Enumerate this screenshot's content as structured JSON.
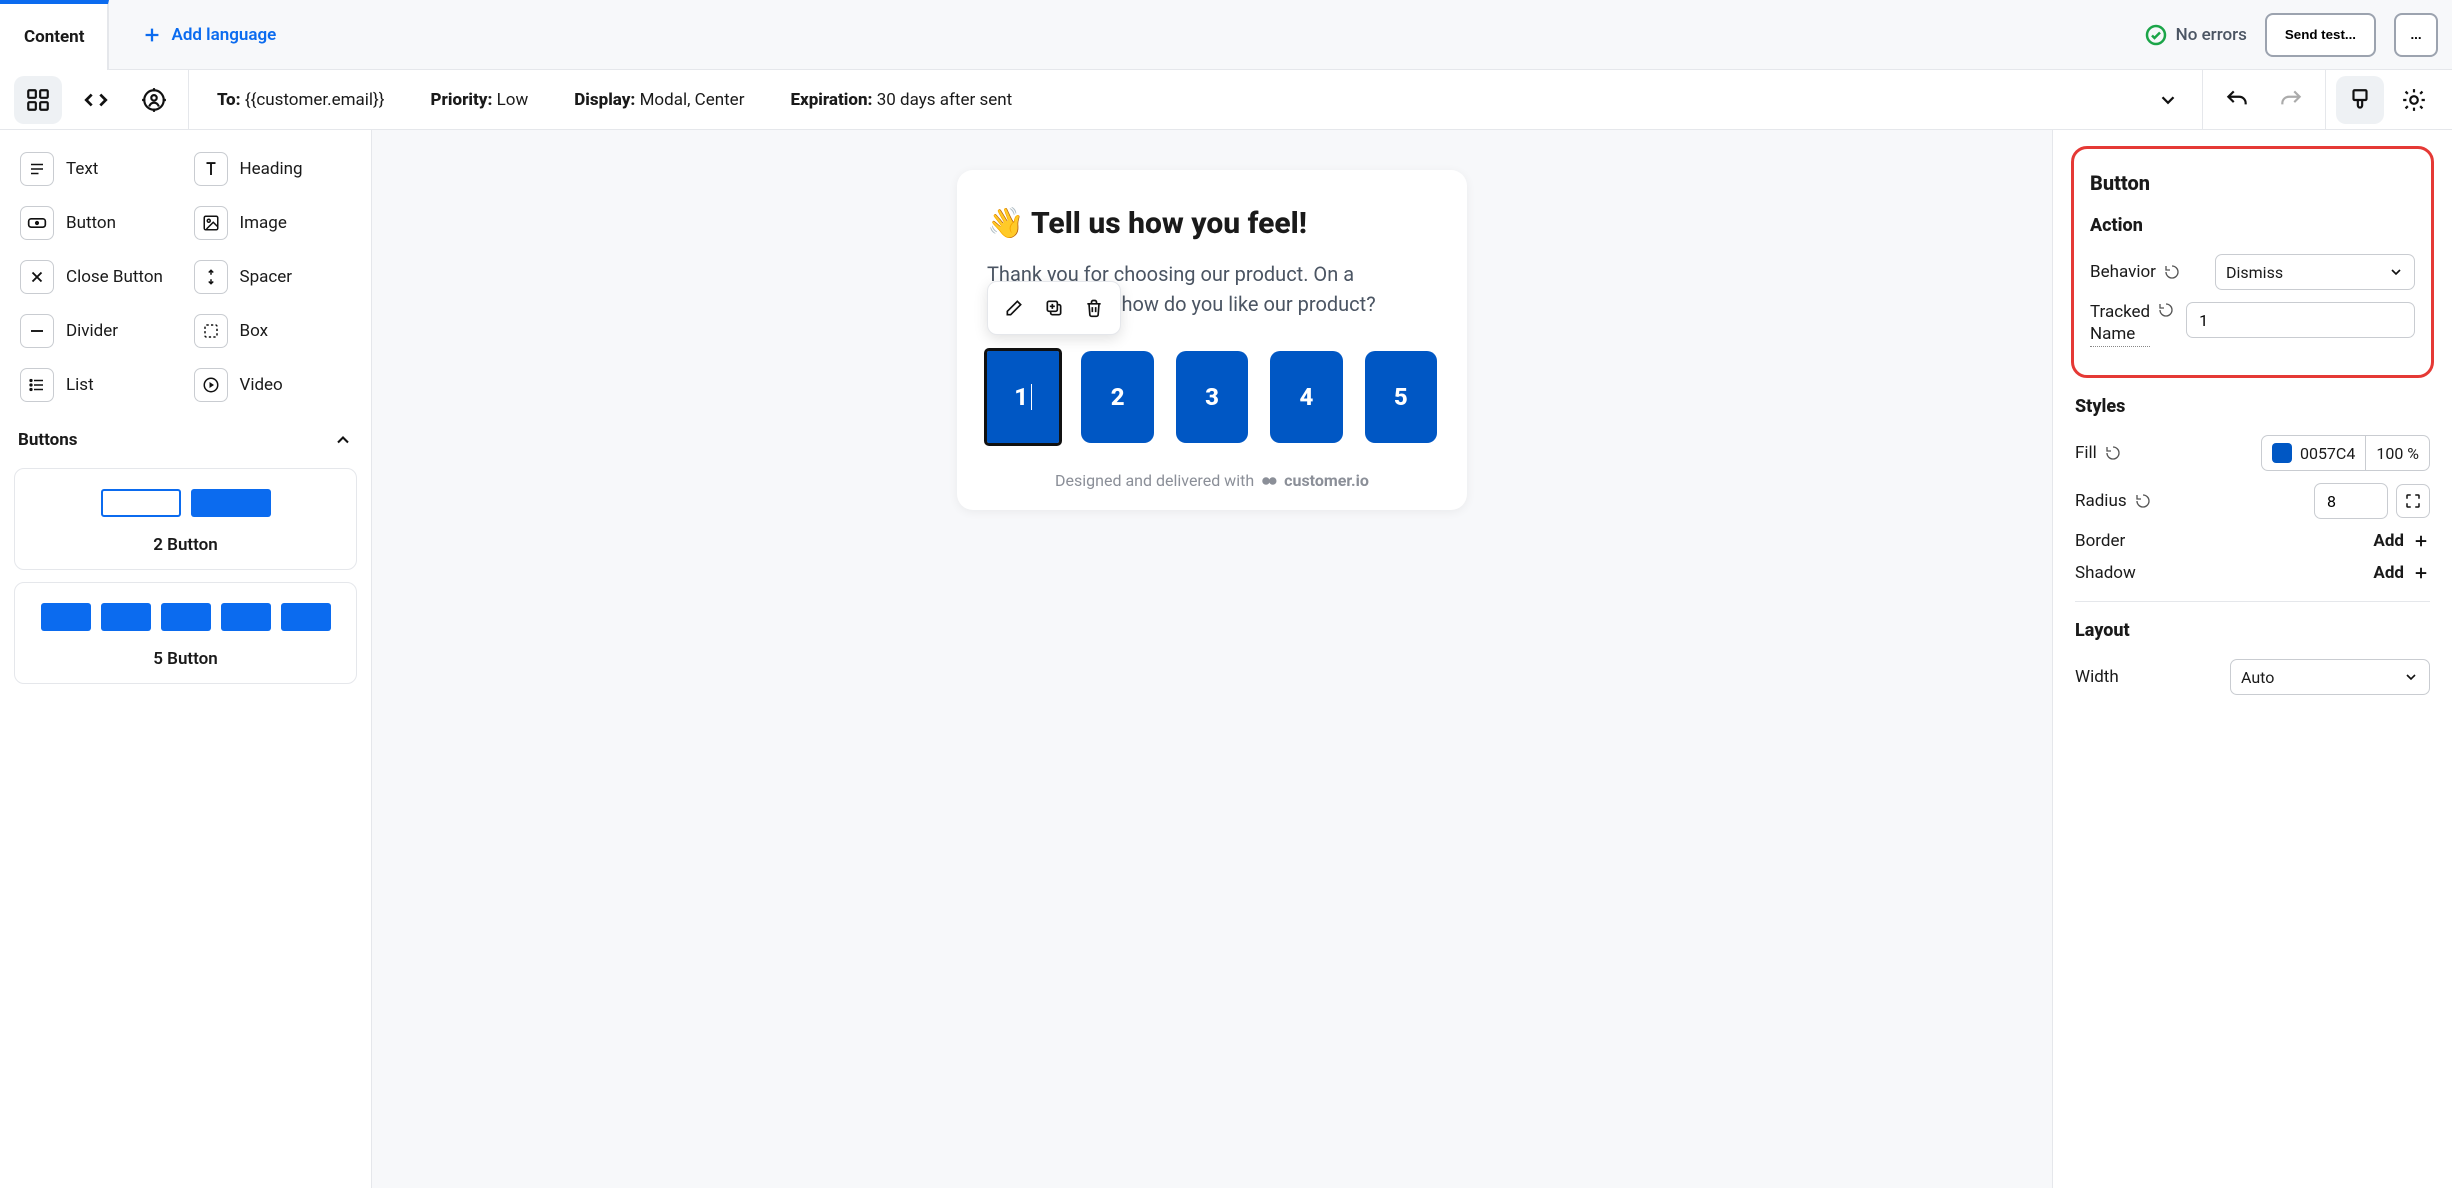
{
  "tabs": {
    "content": "Content",
    "add_language": "Add language"
  },
  "status": {
    "no_errors": "No errors",
    "send_test": "Send test...",
    "more": "..."
  },
  "meta": {
    "to_label": "To:",
    "to_value": "{{customer.email}}",
    "priority_label": "Priority:",
    "priority_value": "Low",
    "display_label": "Display:",
    "display_value": "Modal, Center",
    "expiration_label": "Expiration:",
    "expiration_value": "30 days after sent"
  },
  "blocks": [
    {
      "label": "Text"
    },
    {
      "label": "Heading"
    },
    {
      "label": "Button"
    },
    {
      "label": "Image"
    },
    {
      "label": "Close Button"
    },
    {
      "label": "Spacer"
    },
    {
      "label": "Divider"
    },
    {
      "label": "Box"
    },
    {
      "label": "List"
    },
    {
      "label": "Video"
    }
  ],
  "buttons_section": {
    "title": "Buttons",
    "preset2": "2 Button",
    "preset5": "5 Button"
  },
  "canvas": {
    "title": "👋 Tell us how you feel!",
    "body_line1": "Thank you for choosing our product. On a",
    "body_line2_trail": "how do you like our product?",
    "ratings": [
      "1",
      "2",
      "3",
      "4",
      "5"
    ],
    "footer_prefix": "Designed and delivered with",
    "footer_brand": "customer.io"
  },
  "inspector": {
    "title": "Button",
    "action_header": "Action",
    "behavior_label": "Behavior",
    "behavior_value": "Dismiss",
    "tracked_name_label_line1": "Tracked",
    "tracked_name_label_line2": "Name",
    "tracked_name_value": "1",
    "styles_header": "Styles",
    "fill_label": "Fill",
    "fill_value": "0057C4",
    "fill_opacity": "100 %",
    "radius_label": "Radius",
    "radius_value": "8",
    "border_label": "Border",
    "shadow_label": "Shadow",
    "add_label": "Add",
    "layout_header": "Layout",
    "width_label": "Width",
    "width_value": "Auto"
  }
}
